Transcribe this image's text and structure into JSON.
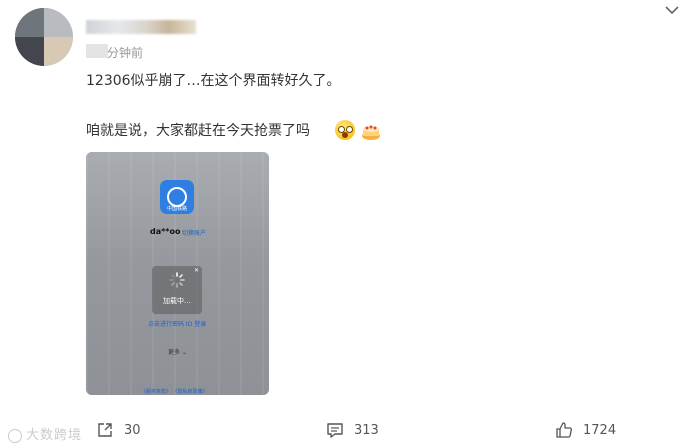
{
  "post": {
    "timestamp": "分钟前",
    "text_line1": "12306似乎崩了…在这个界面转好久了。",
    "text_line2": "咱就是说，大家都赶在今天抢票了吗",
    "menu_icon": "chevron-down-icon"
  },
  "screenshot": {
    "app_caption": "中国铁路",
    "account": "da**oo",
    "switch_account": "切换账户",
    "loading": "加载中…",
    "login_link": "点击进行密码 ID 登录",
    "more": "更多",
    "footer": "《服务条款》 《隐私权政策》"
  },
  "actions": {
    "share_count": "30",
    "comment_count": "313",
    "like_count": "1724"
  },
  "watermark": "大数跨境"
}
